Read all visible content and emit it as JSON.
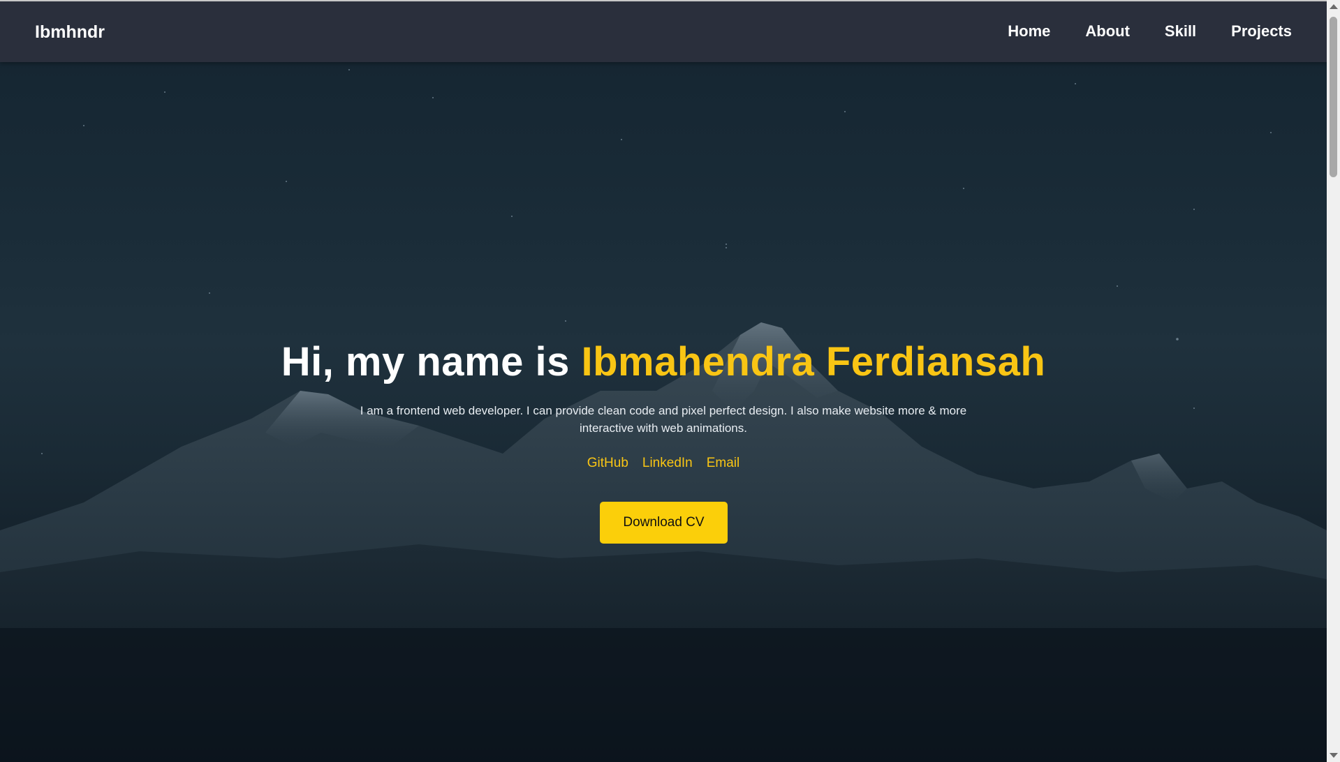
{
  "navbar": {
    "brand": "Ibmhndr",
    "links": [
      {
        "label": "Home"
      },
      {
        "label": "About"
      },
      {
        "label": "Skill"
      },
      {
        "label": "Projects"
      }
    ]
  },
  "hero": {
    "greeting": "Hi, my name is ",
    "name": "Ibmahendra Ferdiansah",
    "description": "I am a frontend web developer. I can provide clean code and pixel perfect design. I also make website more & more interactive with web animations.",
    "socials": [
      {
        "label": "GitHub"
      },
      {
        "label": "LinkedIn"
      },
      {
        "label": "Email"
      }
    ],
    "cta_label": "Download CV"
  },
  "colors": {
    "accent": "#f9c514",
    "button": "#fbcf0a",
    "navbar_bg": "#2a2f3c",
    "text": "#ffffff"
  },
  "icons": {
    "background": "mountain-night-image"
  }
}
